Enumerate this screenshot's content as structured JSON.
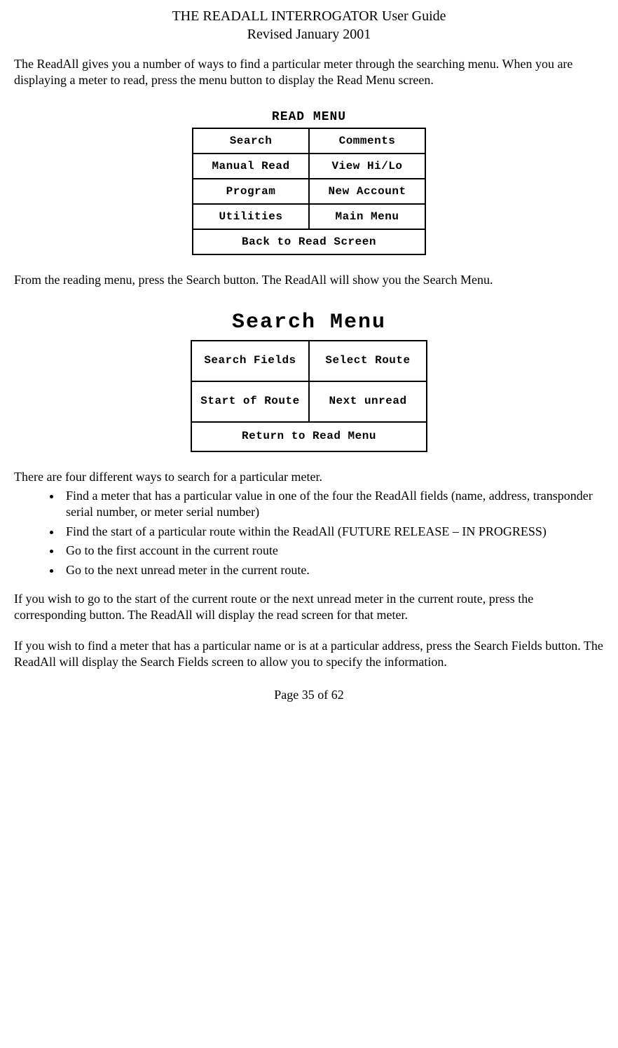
{
  "header": {
    "title": "THE READALL INTERROGATOR User Guide",
    "subtitle": "Revised January 2001"
  },
  "paragraphs": {
    "p1": "The ReadAll gives you a number of ways to find a particular meter through the searching menu.  When you are displaying a meter to read, press the menu button to display the Read Menu screen.",
    "p2": "From the reading menu, press the Search button.  The ReadAll will show you the Search Menu.",
    "p3": "There are four different ways to search for a particular meter.",
    "p4": "If you wish to go to the start of the current route or the next unread meter in the current route, press the corresponding button.  The ReadAll will display the read screen for that meter.",
    "p5": "If you wish to find a meter that has a particular name or is at a particular address, press the Search Fields button.  The ReadAll will display the Search Fields screen to allow you to specify the information."
  },
  "read_menu": {
    "title": "READ MENU",
    "buttons": {
      "search": "Search",
      "comments": "Comments",
      "manual_read": "Manual Read",
      "view_hilo": "View Hi/Lo",
      "program": "Program",
      "new_account": "New Account",
      "utilities": "Utilities",
      "main_menu": "Main Menu",
      "back": "Back to Read Screen"
    }
  },
  "search_menu": {
    "title": "Search Menu",
    "buttons": {
      "search_fields": "Search Fields",
      "select_route": "Select Route",
      "start_route": "Start of Route",
      "next_unread": "Next unread",
      "return": "Return to Read Menu"
    }
  },
  "bullets": {
    "b1": "Find a meter that has a particular value in one of the four the ReadAll fields (name, address, transponder serial number, or meter serial number)",
    "b2": "Find the start of a particular route within the ReadAll (FUTURE RELEASE – IN PROGRESS)",
    "b3": "Go to the first account in the current route",
    "b4": "Go to the next unread meter in the current route."
  },
  "footer": "Page 35 of 62"
}
